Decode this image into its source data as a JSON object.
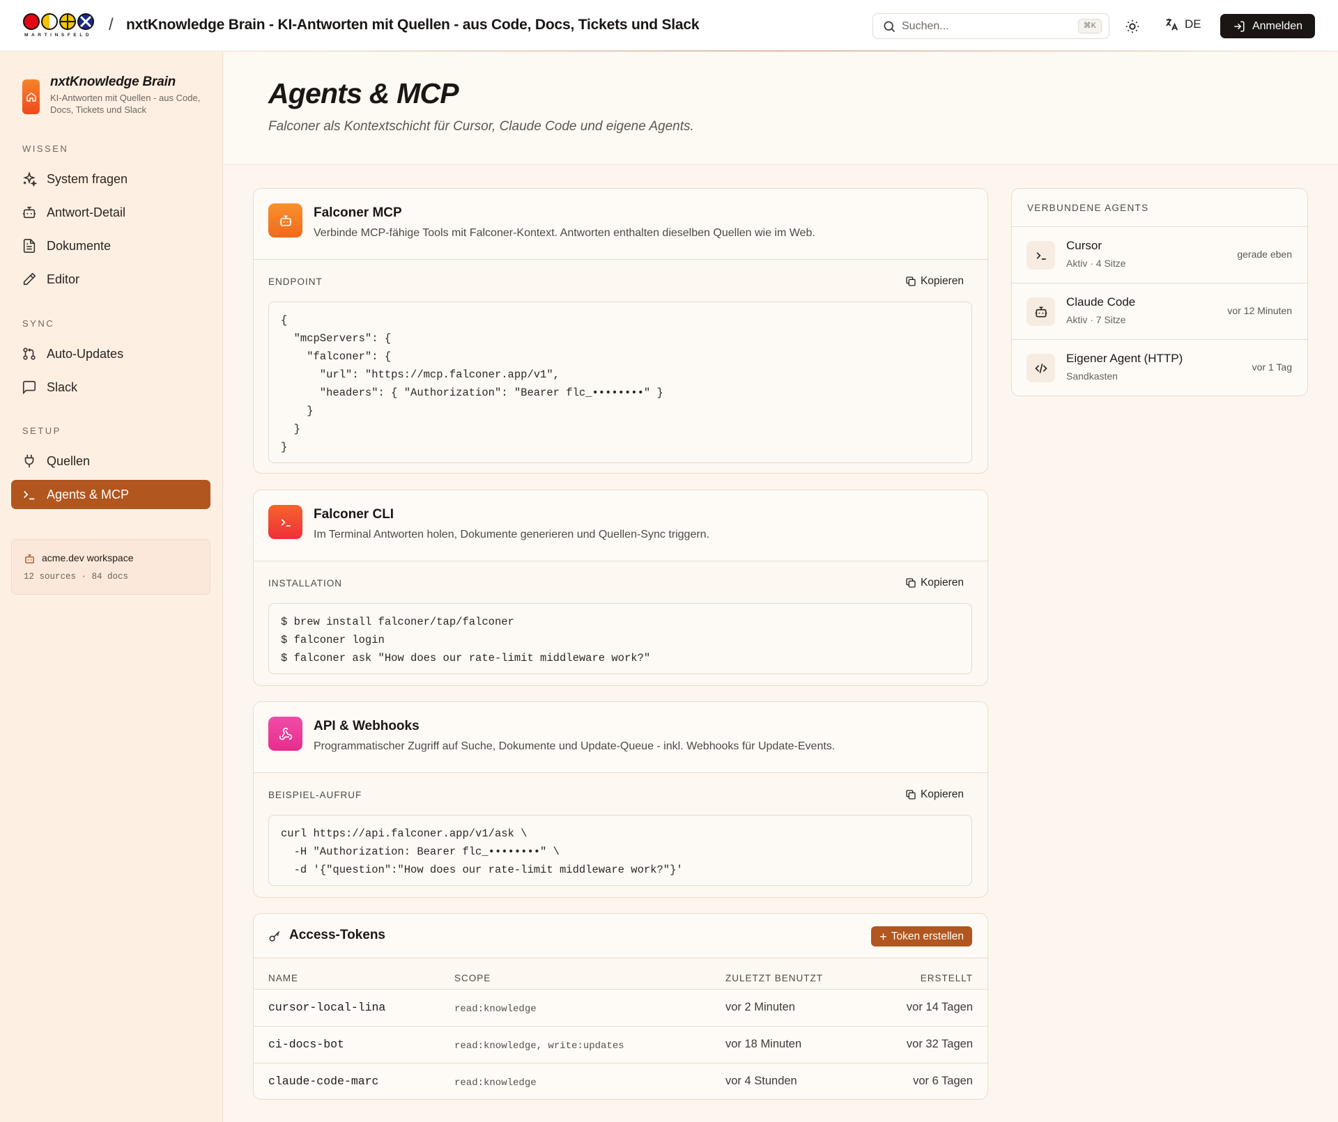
{
  "header": {
    "logo_word": "MARTINSFELD",
    "separator": "/",
    "title": "nxtKnowledge Brain - KI-Antworten mit Quellen - aus Code, Docs, Tickets und Slack",
    "search_placeholder": "Suchen...",
    "search_shortcut": "⌘K",
    "language": "DE",
    "login_label": "Anmelden"
  },
  "sidebar": {
    "brand_title": "nxtKnowledge Brain",
    "brand_subtitle": "KI-Antworten mit Quellen - aus Code, Docs, Tickets und Slack",
    "sections": {
      "wissen": "WISSEN",
      "sync": "SYNC",
      "setup": "SETUP"
    },
    "items": [
      {
        "label": "System fragen",
        "icon": "sparkles-icon"
      },
      {
        "label": "Antwort-Detail",
        "icon": "bot-icon"
      },
      {
        "label": "Dokumente",
        "icon": "document-icon"
      },
      {
        "label": "Editor",
        "icon": "pencil-icon"
      },
      {
        "label": "Auto-Updates",
        "icon": "git-pull-request-icon"
      },
      {
        "label": "Slack",
        "icon": "message-square-icon"
      },
      {
        "label": "Quellen",
        "icon": "plug-icon"
      },
      {
        "label": "Agents & MCP",
        "icon": "terminal-icon",
        "active": true
      }
    ],
    "workspace": {
      "name": "acme.dev workspace",
      "meta": "12 sources · 84 docs"
    }
  },
  "page": {
    "title": "Agents & MCP",
    "subtitle": "Falconer als Kontextschicht für Cursor, Claude Code und eigene Agents."
  },
  "cards": {
    "mcp": {
      "title": "Falconer MCP",
      "description": "Verbinde MCP-fähige Tools mit Falconer-Kontext. Antworten enthalten dieselben Quellen wie im Web.",
      "label": "ENDPOINT",
      "copy_label": "Kopieren",
      "code": "{\n  \"mcpServers\": {\n    \"falconer\": {\n      \"url\": \"https://mcp.falconer.app/v1\",\n      \"headers\": { \"Authorization\": \"Bearer flc_••••••••\" }\n    }\n  }\n}"
    },
    "cli": {
      "title": "Falconer CLI",
      "description": "Im Terminal Antworten holen, Dokumente generieren und Quellen-Sync triggern.",
      "label": "INSTALLATION",
      "copy_label": "Kopieren",
      "code": "$ brew install falconer/tap/falconer\n$ falconer login\n$ falconer ask \"How does our rate-limit middleware work?\""
    },
    "api": {
      "title": "API & Webhooks",
      "description": "Programmatischer Zugriff auf Suche, Dokumente und Update-Queue - inkl. Webhooks für Update-Events.",
      "label": "BEISPIEL-AUFRUF",
      "copy_label": "Kopieren",
      "code": "curl https://api.falconer.app/v1/ask \\\n  -H \"Authorization: Bearer flc_••••••••\" \\\n  -d '{\"question\":\"How does our rate-limit middleware work?\"}'"
    }
  },
  "tokens": {
    "title": "Access-Tokens",
    "create_label": "Token erstellen",
    "columns": [
      "NAME",
      "SCOPE",
      "ZULETZT BENUTZT",
      "ERSTELLT"
    ],
    "rows": [
      {
        "name": "cursor-local-lina",
        "scope": "read:knowledge",
        "last_used": "vor 2 Minuten",
        "created": "vor 14 Tagen"
      },
      {
        "name": "ci-docs-bot",
        "scope": "read:knowledge, write:updates",
        "last_used": "vor 18 Minuten",
        "created": "vor 32 Tagen"
      },
      {
        "name": "claude-code-marc",
        "scope": "read:knowledge",
        "last_used": "vor 4 Stunden",
        "created": "vor 6 Tagen"
      }
    ]
  },
  "agents": {
    "heading": "VERBUNDENE AGENTS",
    "items": [
      {
        "name": "Cursor",
        "status": "Aktiv · 4 Sitze",
        "time": "gerade eben",
        "icon": "terminal-icon"
      },
      {
        "name": "Claude Code",
        "status": "Aktiv · 7 Sitze",
        "time": "vor 12 Minuten",
        "icon": "bot-icon"
      },
      {
        "name": "Eigener Agent (HTTP)",
        "status": "Sandkasten",
        "time": "vor 1 Tag",
        "icon": "code-icon"
      }
    ]
  },
  "colors": {
    "accent": "#b0561e",
    "sidebar_bg": "#fdf0e3",
    "page_bg": "#fcf6ee",
    "mcp_icon": "#f7842a",
    "cli_icon": "#f1432a",
    "api_icon": "#ec3fa0"
  }
}
